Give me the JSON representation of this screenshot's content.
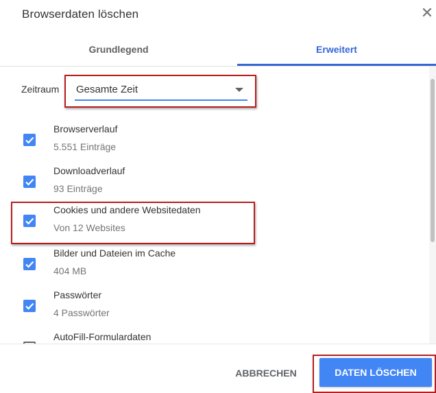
{
  "dialog": {
    "title": "Browserdaten löschen",
    "close_icon": "close-icon"
  },
  "tabs": [
    {
      "label": "Grundlegend",
      "active": false
    },
    {
      "label": "Erweitert",
      "active": true
    }
  ],
  "time_range": {
    "label": "Zeitraum",
    "value": "Gesamte Zeit"
  },
  "items": [
    {
      "title": "Browserverlauf",
      "subtitle": "5.551 Einträge",
      "checked": true
    },
    {
      "title": "Downloadverlauf",
      "subtitle": "93 Einträge",
      "checked": true
    },
    {
      "title": "Cookies und andere Websitedaten",
      "subtitle": "Von 12 Websites",
      "checked": true
    },
    {
      "title": "Bilder und Dateien im Cache",
      "subtitle": "404 MB",
      "checked": true
    },
    {
      "title": "Passwörter",
      "subtitle": "4 Passwörter",
      "checked": true
    },
    {
      "title": "AutoFill-Formulardaten",
      "subtitle": "",
      "checked": false
    }
  ],
  "footer": {
    "cancel_label": "ABBRECHEN",
    "delete_label": "DATEN LÖSCHEN"
  },
  "colors": {
    "accent": "#4285f4",
    "tab_active": "#3367d6",
    "highlight": "#b71c1c"
  }
}
